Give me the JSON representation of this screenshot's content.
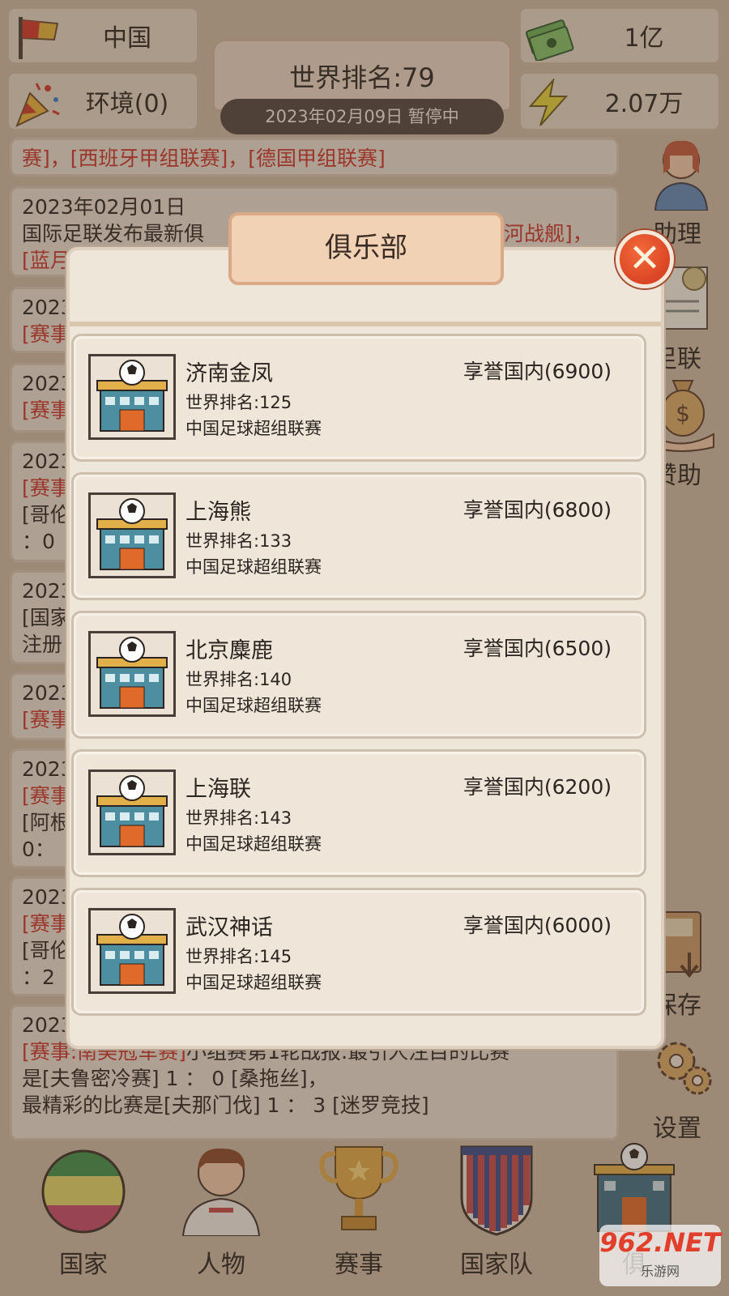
{
  "header": {
    "country": "中国",
    "environment": "环境(0)",
    "money": "1亿",
    "energy": "2.07万",
    "world_rank_label": "世界排名:79",
    "date_status": "2023年02月09日  暂停中"
  },
  "news": [
    {
      "line1": "赛]，[西班牙甲组联赛]，[德国甲组联赛]"
    },
    {
      "date": "2023年02月01日",
      "line2a": "国际足联发布最新俱",
      "line2b": "银河战舰]，",
      "line3": "[蓝月"
    },
    {
      "date": "2023",
      "line2": "[赛事"
    },
    {
      "date": "2023",
      "line2": "[赛事"
    },
    {
      "date": "2023",
      "line2": "[赛事",
      "line3": "[哥伦",
      "line4": "：0"
    },
    {
      "date": "2023",
      "line2": "[国家",
      "line3": "注册"
    },
    {
      "date": "2023",
      "line2": "[赛事"
    },
    {
      "date": "2023",
      "line2": "[赛事",
      "line3": "[阿根",
      "line4": "0："
    },
    {
      "date": "2023",
      "line2": "[赛事",
      "line3": "[哥伦",
      "line4": "：2"
    },
    {
      "date": "2023",
      "tag": "[赛事:南美冠军赛]",
      "text": "小组赛第1轮战报:最引人注目的比赛",
      "line3": "是[夫鲁密冷赛]  1 ： 0 [桑拖丝]，",
      "line4": "最精彩的比赛是[夫那门伐]  1 ： 3 [迷罗竞技]"
    }
  ],
  "sidebar": {
    "assistant": "助理",
    "league": "足联",
    "sponsor": "赞助",
    "save": "保存",
    "settings": "设置"
  },
  "nav": {
    "country": "国家",
    "people": "人物",
    "events": "赛事",
    "national_team": "国家队",
    "club": "俱"
  },
  "modal": {
    "title": "俱乐部",
    "close": "✕"
  },
  "clubs": [
    {
      "name": "济南金凤",
      "rank": "世界排名:125",
      "league": "中国足球超组联赛",
      "reputation": "享誉国内",
      "points": "6900"
    },
    {
      "name": "上海熊",
      "rank": "世界排名:133",
      "league": "中国足球超组联赛",
      "reputation": "享誉国内",
      "points": "6800"
    },
    {
      "name": "北京麋鹿",
      "rank": "世界排名:140",
      "league": "中国足球超组联赛",
      "reputation": "享誉国内",
      "points": "6500"
    },
    {
      "name": "上海联",
      "rank": "世界排名:143",
      "league": "中国足球超组联赛",
      "reputation": "享誉国内",
      "points": "6200"
    },
    {
      "name": "武汉神话",
      "rank": "世界排名:145",
      "league": "中国足球超组联赛",
      "reputation": "享誉国内",
      "points": "6000"
    }
  ],
  "watermark": {
    "big": "962.NET",
    "small": "乐游网"
  },
  "colors": {
    "accent_red": "#c8322a",
    "panel": "#efe6da",
    "dark_bar": "#4f4440"
  }
}
